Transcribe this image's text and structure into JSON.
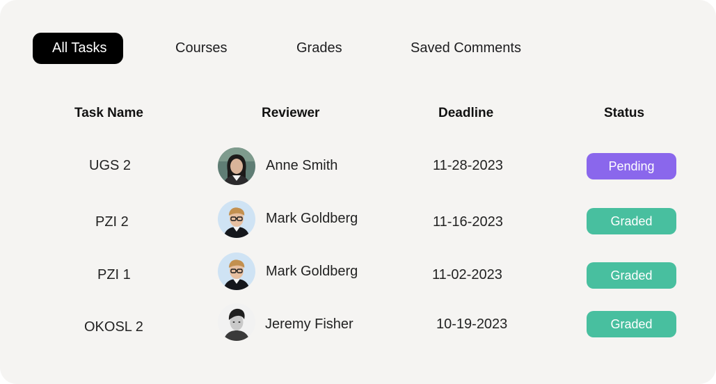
{
  "tabs": [
    {
      "label": "All Tasks",
      "active": true
    },
    {
      "label": "Courses",
      "active": false
    },
    {
      "label": "Grades",
      "active": false
    },
    {
      "label": "Saved Comments",
      "active": false
    }
  ],
  "table": {
    "headers": [
      "Task Name",
      "Reviewer",
      "Deadline",
      "Status"
    ],
    "rows": [
      {
        "task": "UGS 2",
        "reviewer": "Anne Smith",
        "avatar": "woman-portrait-icon",
        "deadline": "11-28-2023",
        "status": "Pending"
      },
      {
        "task": "PZI 2",
        "reviewer": "Mark Goldberg",
        "avatar": "man-glasses-portrait-icon",
        "deadline": "11-16-2023",
        "status": "Graded"
      },
      {
        "task": "PZI 1",
        "reviewer": "Mark Goldberg",
        "avatar": "man-glasses-portrait-icon",
        "deadline": "11-02-2023",
        "status": "Graded"
      },
      {
        "task": "OKOSL 2",
        "reviewer": "Jeremy Fisher",
        "avatar": "man-bw-portrait-icon",
        "deadline": "10-19-2023",
        "status": "Graded"
      }
    ]
  },
  "colors": {
    "background": "#f5f4f2",
    "active_tab": "#000000",
    "pending": "#8a67ec",
    "graded": "#48bf9f"
  }
}
